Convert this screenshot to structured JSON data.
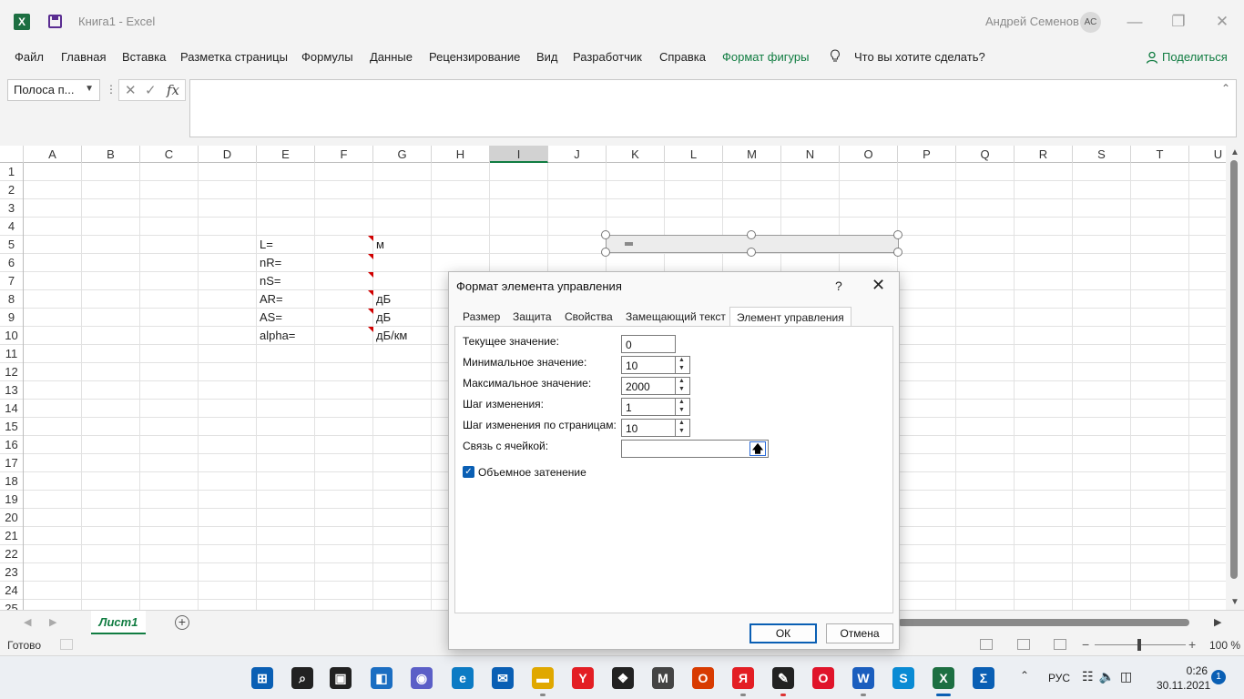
{
  "window": {
    "app_icon": "X",
    "title": "Книга1  -  Excel",
    "user_name": "Андрей Семенов",
    "user_initials": "АС",
    "minimize": "—",
    "restore": "❐",
    "close": "✕"
  },
  "ribbon": {
    "tabs": [
      "Файл",
      "Главная",
      "Вставка",
      "Разметка страницы",
      "Формулы",
      "Данные",
      "Рецензирование",
      "Вид",
      "Разработчик",
      "Справка",
      "Формат фигуры"
    ],
    "search": "Что вы хотите сделать?",
    "share": "Поделиться"
  },
  "formula_bar": {
    "name_box": "Полоса п...",
    "dots": "⋮",
    "cancel": "✕",
    "enter": "✓",
    "fx": "fx",
    "value": ""
  },
  "sheet": {
    "columns": [
      "A",
      "B",
      "C",
      "D",
      "E",
      "F",
      "G",
      "H",
      "I",
      "J",
      "K",
      "L",
      "M",
      "N",
      "O",
      "P",
      "Q",
      "R",
      "S",
      "T",
      "U"
    ],
    "selected_column": "I",
    "rows": [
      "1",
      "2",
      "3",
      "4",
      "5",
      "6",
      "7",
      "8",
      "9",
      "10",
      "11",
      "12",
      "13",
      "14",
      "15",
      "16",
      "17",
      "18",
      "19",
      "20",
      "21",
      "22",
      "23",
      "24",
      "25"
    ],
    "cells": [
      {
        "ref": "E5",
        "text": "L="
      },
      {
        "ref": "G5",
        "text": "м"
      },
      {
        "ref": "E6",
        "text": "nR="
      },
      {
        "ref": "E7",
        "text": "nS="
      },
      {
        "ref": "E8",
        "text": "AR="
      },
      {
        "ref": "G8",
        "text": "дБ"
      },
      {
        "ref": "E9",
        "text": "AS="
      },
      {
        "ref": "G9",
        "text": "дБ"
      },
      {
        "ref": "E10",
        "text": "alpha="
      },
      {
        "ref": "G10",
        "text": "дБ/км"
      }
    ],
    "comment_markers": [
      "F5",
      "F6",
      "F7",
      "F8",
      "F9",
      "F10"
    ],
    "tab_name": "Лист1",
    "add_sheet": "+"
  },
  "status": {
    "ready": "Готово",
    "zoom_minus": "−",
    "zoom_plus": "+",
    "zoom": "100 %",
    "zoom_level": 1.0
  },
  "dialog": {
    "title": "Формат элемента управления",
    "help": "?",
    "close": "✕",
    "tabs": [
      "Размер",
      "Защита",
      "Свойства",
      "Замещающий текст",
      "Элемент управления"
    ],
    "active_tab": "Элемент управления",
    "fields": [
      {
        "label": "Текущее значение:",
        "value": "0",
        "spinner": false
      },
      {
        "label": "Минимальное значение:",
        "value": "10",
        "spinner": true
      },
      {
        "label": "Максимальное значение:",
        "value": "2000",
        "spinner": true
      },
      {
        "label": "Шаг изменения:",
        "value": "1",
        "spinner": true
      },
      {
        "label": "Шаг изменения по страницам:",
        "value": "10",
        "spinner": true
      }
    ],
    "cell_link_label": "Связь с ячейкой:",
    "cell_link_value": "",
    "shading_label": "Объемное затенение",
    "shading_checked": true,
    "ok": "ОК",
    "cancel": "Отмена"
  },
  "taskbar": {
    "language": "РУС",
    "time": "0:26",
    "date": "30.11.2021",
    "notifications": "1",
    "apps": [
      {
        "name": "start",
        "glyph": "⊞",
        "color": "#0a5fb4"
      },
      {
        "name": "search",
        "glyph": "⌕",
        "color": "#222"
      },
      {
        "name": "task-view",
        "glyph": "▣",
        "color": "#222"
      },
      {
        "name": "widgets",
        "glyph": "◧",
        "color": "#1b6ec2"
      },
      {
        "name": "chat",
        "glyph": "◉",
        "color": "#5b5fc7"
      },
      {
        "name": "edge",
        "glyph": "e",
        "color": "#0c7bc4"
      },
      {
        "name": "mail",
        "glyph": "✉",
        "color": "#0a5fb4"
      },
      {
        "name": "explorer",
        "glyph": "▬",
        "color": "#e0a800"
      },
      {
        "name": "yandex-browser",
        "glyph": "Y",
        "color": "#e31e24"
      },
      {
        "name": "dropbox",
        "glyph": "❖",
        "color": "#222"
      },
      {
        "name": "app-m",
        "glyph": "M",
        "color": "#444"
      },
      {
        "name": "office",
        "glyph": "O",
        "color": "#d83b01"
      },
      {
        "name": "yandex",
        "glyph": "Я",
        "color": "#e31e24"
      },
      {
        "name": "app-pen",
        "glyph": "✎",
        "color": "#222"
      },
      {
        "name": "opera",
        "glyph": "O",
        "color": "#e0142a"
      },
      {
        "name": "word",
        "glyph": "W",
        "color": "#1b5ebe"
      },
      {
        "name": "skype",
        "glyph": "S",
        "color": "#0a8bd4"
      },
      {
        "name": "excel",
        "glyph": "X",
        "color": "#1d6f42"
      },
      {
        "name": "sigma",
        "glyph": "Σ",
        "color": "#0a5fb4"
      }
    ]
  }
}
